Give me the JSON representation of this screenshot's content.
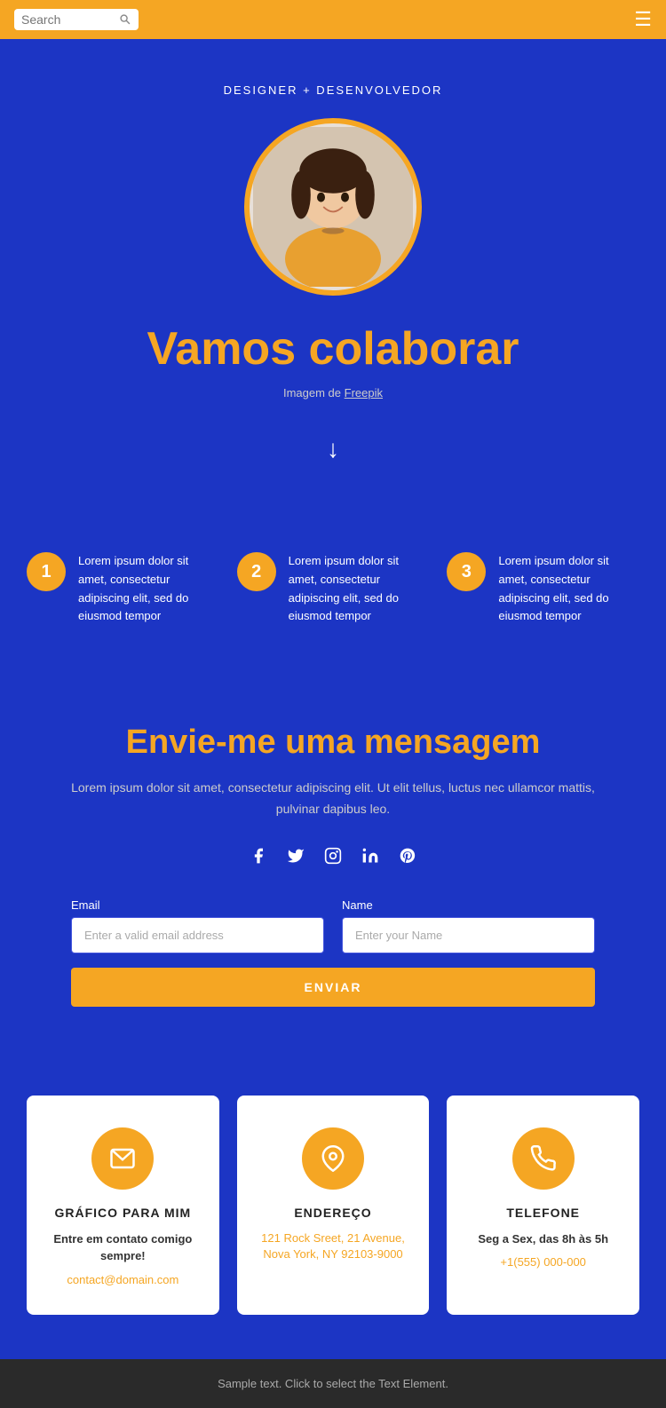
{
  "header": {
    "search_placeholder": "Search",
    "hamburger_label": "☰"
  },
  "hero": {
    "subtitle": "DESIGNER + DESENVOLVEDOR",
    "title": "Vamos colaborar",
    "credit_text": "Imagem de ",
    "credit_link": "Freepik",
    "arrow": "↓"
  },
  "steps": [
    {
      "number": "1",
      "text": "Lorem ipsum dolor sit amet, consectetur adipiscing elit, sed do eiusmod tempor"
    },
    {
      "number": "2",
      "text": "Lorem ipsum dolor sit amet, consectetur adipiscing elit, sed do eiusmod tempor"
    },
    {
      "number": "3",
      "text": "Lorem ipsum dolor sit amet, consectetur adipiscing elit, sed do eiusmod tempor"
    }
  ],
  "contact": {
    "title": "Envie-me uma mensagem",
    "description": "Lorem ipsum dolor sit amet, consectetur adipiscing elit. Ut elit tellus, luctus nec ullamcor mattis, pulvinar dapibus leo.",
    "social_icons": [
      "f",
      "𝕏",
      "⊕",
      "in",
      "𝓟"
    ],
    "email_label": "Email",
    "email_placeholder": "Enter a valid email address",
    "name_label": "Name",
    "name_placeholder": "Enter your Name",
    "submit_label": "ENVIAR"
  },
  "cards": [
    {
      "icon": "✉",
      "title": "GRÁFICO PARA MIM",
      "desc": "Entre em contato comigo sempre!",
      "link": "contact@domain.com",
      "link_label": "contact@domain.com"
    },
    {
      "icon": "📍",
      "title": "ENDEREÇO",
      "desc": "",
      "link": "121 Rock Sreet, 21 Avenue, Nova York, NY 92103-9000",
      "link_label": "121 Rock Sreet, 21 Avenue, Nova York, NY 92103-9000"
    },
    {
      "icon": "📞",
      "title": "TELEFONE",
      "desc": "Seg a Sex, das 8h às 5h",
      "link": "+1(555) 000-000",
      "link_label": "+1(555) 000-000"
    }
  ],
  "footer": {
    "text": "Sample text. Click to select the Text Element."
  },
  "colors": {
    "primary_blue": "#1C35C4",
    "accent_orange": "#F5A623",
    "header_bg": "#F5A623",
    "footer_bg": "#2a2a2a"
  }
}
